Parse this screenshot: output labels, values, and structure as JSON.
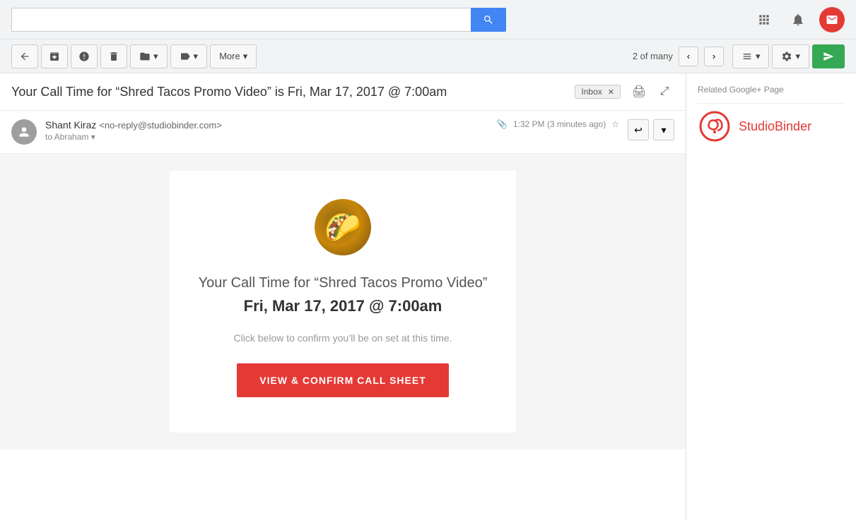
{
  "topbar": {
    "search_placeholder": "",
    "search_btn_label": "Search"
  },
  "toolbar": {
    "back_label": "",
    "archive_label": "",
    "spam_label": "",
    "delete_label": "",
    "move_label": "",
    "labels_label": "",
    "more_label": "More",
    "pagination_text": "2 of many",
    "settings_label": "",
    "send_label": ""
  },
  "email": {
    "subject": "Your Call Time for “Shred Tacos Promo Video” is Fri, Mar 17, 2017 @ 7:00am",
    "inbox_label": "Inbox",
    "from_name": "Shant Kiraz",
    "from_email": "<no-reply@studiobinder.com>",
    "to_label": "to Abraham",
    "timestamp": "1:32 PM (3 minutes ago)",
    "body": {
      "project_title": "“Shred Tacos Promo Video”",
      "call_time_line": "Your Call Time for “Shred Tacos Promo Video”",
      "date_line": "Fri, Mar 17, 2017 @ 7:00am",
      "subtitle": "Click below to confirm you’ll be on set at this time.",
      "confirm_btn": "VIEW & CONFIRM CALL SHEET"
    }
  },
  "sidebar": {
    "related_label": "Related Google+ Page",
    "brand_name": "StudioBinder"
  },
  "icons": {
    "grid": "⋮⋮⋮",
    "bell": "🔔",
    "search": "🔍"
  }
}
